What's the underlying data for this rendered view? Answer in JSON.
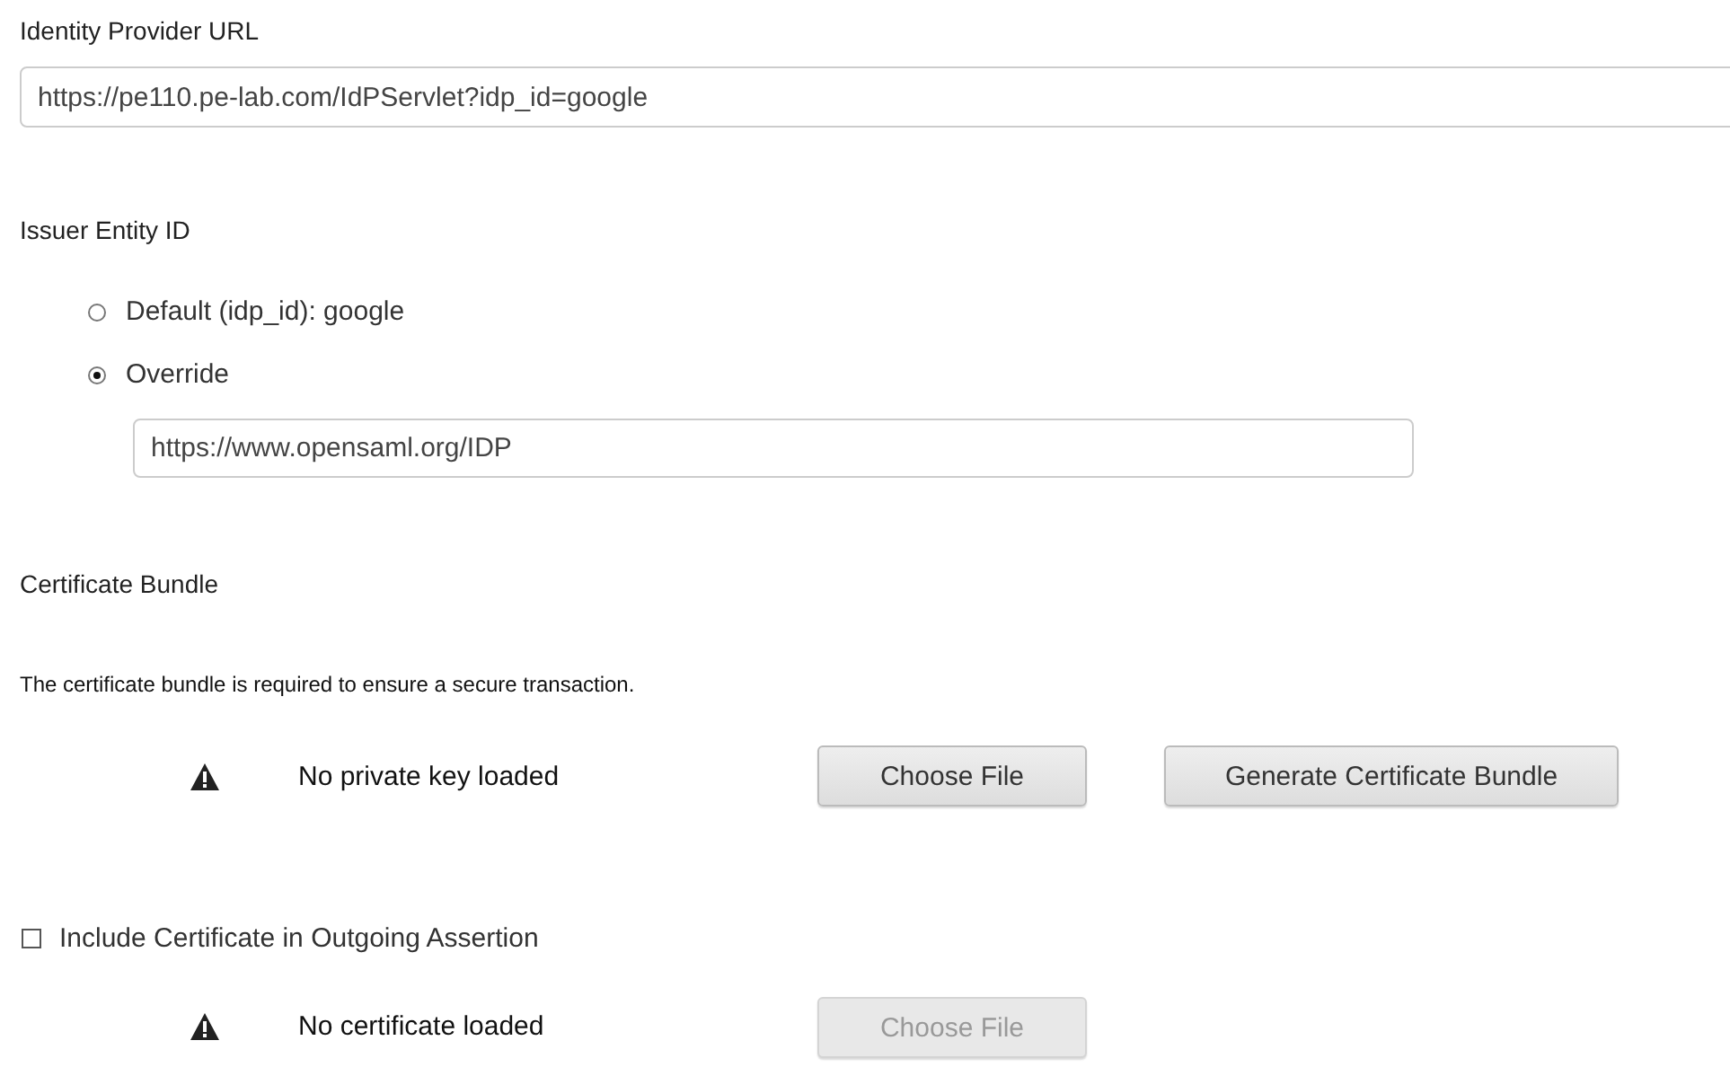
{
  "identity_provider": {
    "label": "Identity Provider URL",
    "value": "https://pe110.pe-lab.com/IdPServlet?idp_id=google"
  },
  "issuer": {
    "label": "Issuer Entity ID",
    "options": [
      {
        "label": "Default (idp_id): google",
        "selected": false
      },
      {
        "label": "Override",
        "selected": true
      }
    ],
    "override_value": "https://www.opensaml.org/IDP"
  },
  "certificate_bundle": {
    "title": "Certificate Bundle",
    "description": "The certificate bundle is required to ensure a secure transaction.",
    "status": "No private key loaded",
    "buttons": [
      {
        "label": "Choose File",
        "disabled": false
      },
      {
        "label": "Generate Certificate Bundle",
        "disabled": false
      }
    ]
  },
  "include_certificate": {
    "label": "Include Certificate in Outgoing Assertion",
    "checked": false,
    "status": "No certificate loaded",
    "buttons": [
      {
        "label": "Choose File",
        "disabled": true
      }
    ]
  }
}
